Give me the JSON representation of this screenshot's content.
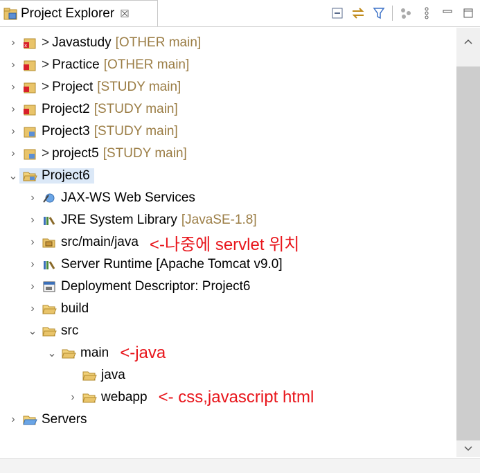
{
  "view": {
    "title": "Project Explorer",
    "close_glyph": "☒",
    "toolbar": [
      {
        "icon": "collapse-all-icon"
      },
      {
        "icon": "link-with-editor-icon"
      },
      {
        "icon": "filter-icon"
      },
      {
        "icon": "git-icon"
      },
      {
        "icon": "view-menu-icon"
      },
      {
        "icon": "minimize-icon"
      },
      {
        "icon": "maximize-icon"
      }
    ]
  },
  "tree": [
    {
      "label": "Javastudy",
      "prefix": ">",
      "deco": "[OTHER main]",
      "expanded": false,
      "icon": "project-error-icon"
    },
    {
      "label": "Practice",
      "prefix": ">",
      "deco": "[OTHER main]",
      "expanded": false,
      "icon": "project-error-icon"
    },
    {
      "label": "Project",
      "prefix": ">",
      "deco": "[STUDY main]",
      "expanded": false,
      "icon": "project-error-icon"
    },
    {
      "label": "Project2",
      "prefix": "",
      "deco": "[STUDY main]",
      "expanded": false,
      "icon": "project-error-icon"
    },
    {
      "label": "Project3",
      "prefix": "",
      "deco": "[STUDY main]",
      "expanded": false,
      "icon": "project-icon"
    },
    {
      "label": "project5",
      "prefix": ">",
      "deco": "[STUDY main]",
      "expanded": false,
      "icon": "project-icon"
    },
    {
      "label": "Project6",
      "prefix": "",
      "deco": "",
      "expanded": true,
      "icon": "project-open-icon"
    },
    {
      "label": "JAX-WS Web Services",
      "deco": "",
      "icon": "webservices-icon"
    },
    {
      "label": "JRE System Library",
      "deco": "[JavaSE-1.8]",
      "icon": "library-icon"
    },
    {
      "label": "src/main/java",
      "deco": "",
      "icon": "package-folder-icon",
      "annotation": "<-나중에 servlet 위치"
    },
    {
      "label": "Server Runtime [Apache Tomcat v9.0]",
      "deco": "",
      "icon": "library-icon"
    },
    {
      "label": "Deployment Descriptor: Project6",
      "deco": "",
      "icon": "descriptor-icon"
    },
    {
      "label": "build",
      "deco": "",
      "icon": "folder-icon"
    },
    {
      "label": "src",
      "deco": "",
      "icon": "folder-open-icon"
    },
    {
      "label": "main",
      "deco": "",
      "icon": "folder-open-icon",
      "annotation": "<-java"
    },
    {
      "label": "java",
      "deco": "",
      "icon": "folder-icon"
    },
    {
      "label": "webapp",
      "deco": "",
      "icon": "folder-icon",
      "annotation": "<- css,javascript html"
    },
    {
      "label": "Servers",
      "deco": "",
      "icon": "folder-icon"
    }
  ],
  "colors": {
    "annotation": "#e8151b",
    "decoration": "#9b7d45",
    "selection": "#dbe8f7"
  }
}
